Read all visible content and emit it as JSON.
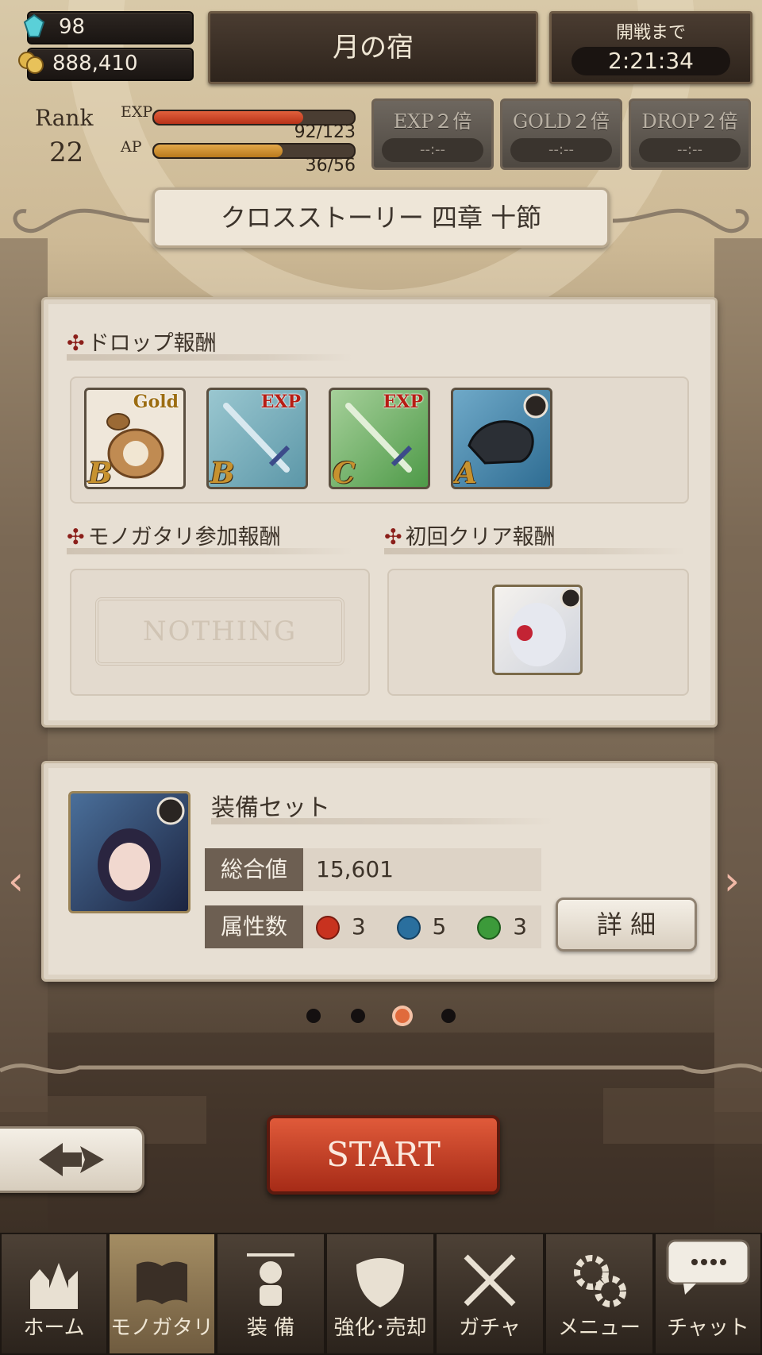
{
  "header": {
    "gems": "98",
    "gold": "888,410",
    "location": "月の宿",
    "battle_label": "開戦まで",
    "battle_timer": "2:21:34",
    "rank_label": "Rank",
    "rank_value": "22",
    "exp_label": "EXP",
    "exp_value": "92/123",
    "exp_fraction": 0.748,
    "ap_label": "AP",
    "ap_value": "36/56",
    "ap_fraction": 0.643,
    "boosts": [
      {
        "label": "EXP２倍",
        "timer": "--:--"
      },
      {
        "label": "GOLD２倍",
        "timer": "--:--"
      },
      {
        "label": "DROP２倍",
        "timer": "--:--"
      }
    ]
  },
  "chapter_title": "クロスストーリー 四章 十節",
  "rewards": {
    "drop_title": "ドロップ報酬",
    "drop_items": [
      {
        "name": "gold-bag",
        "tag": "Gold",
        "grade": "B"
      },
      {
        "name": "exp-sword-blue",
        "tag": "EXP",
        "grade": "B"
      },
      {
        "name": "exp-sword-green",
        "tag": "EXP",
        "grade": "C"
      },
      {
        "name": "dark-gauntlet",
        "tag": "",
        "grade": "A"
      }
    ],
    "participation_title": "モノガタリ参加報酬",
    "participation_value": "NOTHING",
    "first_clear_title": "初回クリア報酬"
  },
  "equipment": {
    "title": "装備セット",
    "total_label": "総合値",
    "total_value": "15,601",
    "attr_label": "属性数",
    "attrs": [
      {
        "name": "fire",
        "value": "3",
        "color": "#c8321f"
      },
      {
        "name": "water",
        "value": "5",
        "color": "#2a6f9e"
      },
      {
        "name": "wind",
        "value": "3",
        "color": "#3c9a3a"
      }
    ],
    "detail_button": "詳 細"
  },
  "pager": {
    "count": 4,
    "active": 3
  },
  "start_button": "START",
  "nav": [
    {
      "label": "ホーム",
      "icon": "castle-icon"
    },
    {
      "label": "モノガタリ",
      "icon": "book-icon"
    },
    {
      "label": "装 備",
      "icon": "puppet-icon"
    },
    {
      "label": "強化･売却",
      "icon": "mask-icon"
    },
    {
      "label": "ガチャ",
      "icon": "crossed-swords-icon"
    },
    {
      "label": "メニュー",
      "icon": "gears-icon"
    },
    {
      "label": "チャット",
      "icon": "speech-bubble-icon"
    }
  ],
  "colors": {
    "accent_red": "#b8381d",
    "panel": "#e7dfd3",
    "nav_active": "#8c7756"
  }
}
